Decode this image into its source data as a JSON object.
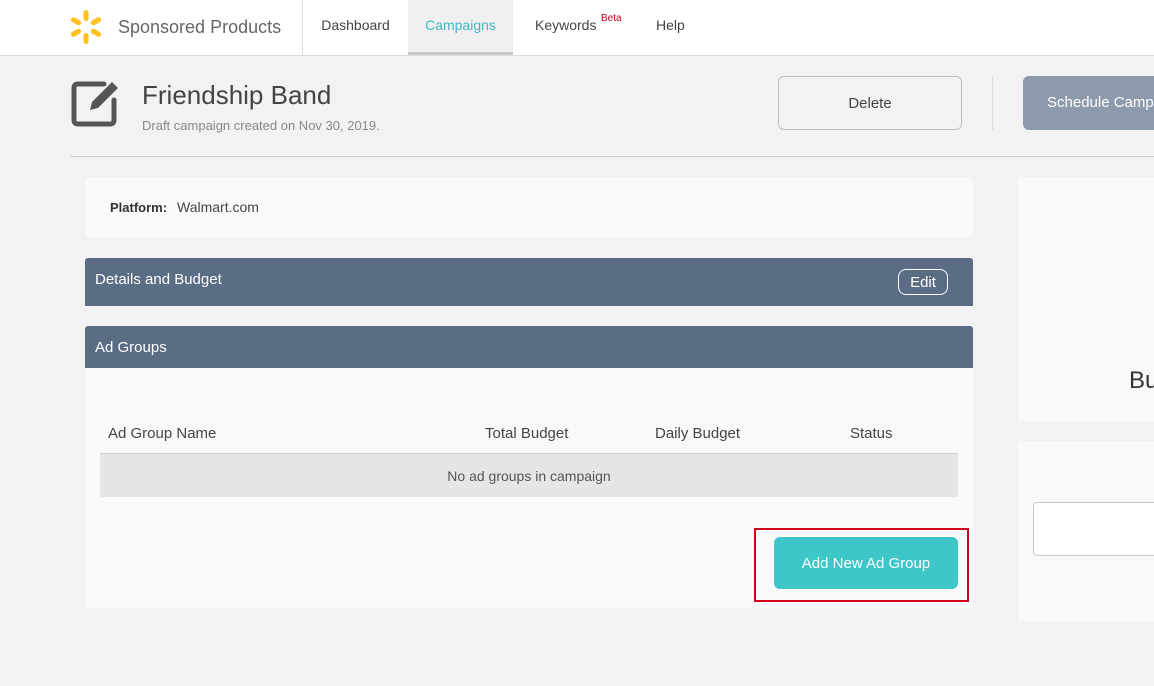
{
  "colors": {
    "accent": "#3fb8c6",
    "panel_header": "#5a6d85",
    "add_button": "#3ec6c8",
    "schedule_button": "#8d9aab",
    "highlight": "#d0021b",
    "logo": "#ffc220"
  },
  "topbar": {
    "logo_icon": "spark-icon",
    "brand": "Sponsored Products",
    "nav": [
      {
        "label": "Dashboard",
        "active": false
      },
      {
        "label": "Campaigns",
        "active": true
      },
      {
        "label": "Keywords",
        "badge": "Beta",
        "active": false
      },
      {
        "label": "Help",
        "active": false
      }
    ]
  },
  "header": {
    "icon": "edit-icon",
    "title": "Friendship Band",
    "subtitle": "Draft campaign created on Nov 30, 2019.",
    "delete_label": "Delete",
    "schedule_label": "Schedule Campaign"
  },
  "platform": {
    "label": "Platform:",
    "value": "Walmart.com"
  },
  "details": {
    "title": "Details and Budget",
    "edit_label": "Edit"
  },
  "ad_groups": {
    "title": "Ad Groups",
    "columns": [
      "Ad Group Name",
      "Total Budget",
      "Daily Budget",
      "Status"
    ],
    "empty_message": "No ad groups in campaign",
    "add_label": "Add New Ad Group"
  },
  "right_panel": {
    "partial_text": "Bu"
  }
}
